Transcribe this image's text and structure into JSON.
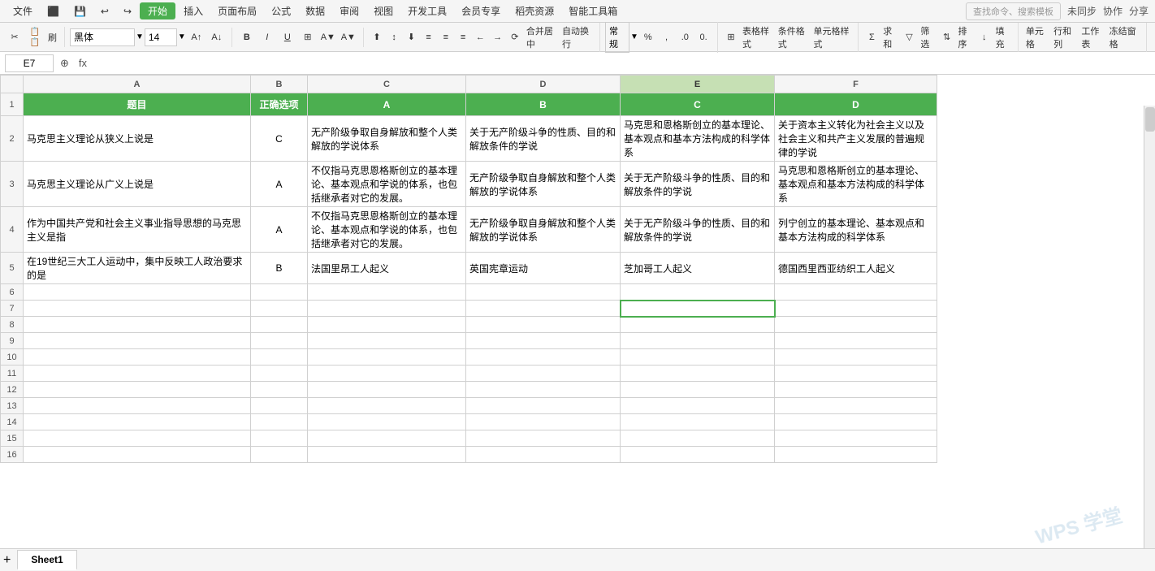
{
  "menubar": {
    "items": [
      "文件",
      "插入",
      "页面布局",
      "公式",
      "数据",
      "审阅",
      "视图",
      "开发工具",
      "会员专享",
      "稻壳资源",
      "智能工具箱"
    ],
    "start_label": "开始",
    "search_placeholder": "查找命令、搜索模板",
    "right_items": [
      "未同步",
      "协作",
      "分享"
    ]
  },
  "toolbar": {
    "font_name": "黑体",
    "font_size": "14",
    "bold": "B",
    "italic": "I",
    "underline": "U",
    "align_left": "≡",
    "align_center": "≡",
    "align_right": "≡",
    "merge": "合并居中",
    "wrap": "自动换行",
    "format": "常规",
    "table_style": "表格样式",
    "cond_format": "条件格式",
    "cell_style": "单元格样式",
    "sum": "求和",
    "filter": "筛选",
    "sort": "排序",
    "fill": "填充",
    "single_cell": "单元格",
    "row_col": "行和列",
    "work_area": "工作表",
    "freeze": "冻结窗格"
  },
  "formula_bar": {
    "cell_ref": "E7",
    "fx_label": "fx",
    "formula_value": ""
  },
  "columns": {
    "row_num_width": 28,
    "headers": [
      "A",
      "B",
      "C",
      "D",
      "E",
      "F"
    ],
    "col_labels": [
      "题目",
      "正确选项",
      "A",
      "B",
      "C",
      "D"
    ]
  },
  "rows": [
    {
      "row": 1,
      "cells": [
        "题目",
        "正确选项",
        "A",
        "B",
        "C",
        "D"
      ],
      "is_header": true
    },
    {
      "row": 2,
      "cells": [
        "马克思主义理论从狭义上说是",
        "C",
        "无产阶级争取自身解放和整个人类解放的学说体系",
        "关于无产阶级斗争的性质、目的和解放条件的学说",
        "马克思和恩格斯创立的基本理论、基本观点和基本方法构成的科学体系",
        "关于资本主义转化为社会主义以及社会主义和共产主义发展的普遍规律的学说"
      ]
    },
    {
      "row": 3,
      "cells": [
        "马克思主义理论从广义上说是",
        "A",
        "不仅指马克思恩格斯创立的基本理论、基本观点和学说的体系，也包括继承者对它的发展。",
        "无产阶级争取自身解放和整个人类解放的学说体系",
        "关于无产阶级斗争的性质、目的和解放条件的学说",
        "马克思和恩格斯创立的基本理论、基本观点和基本方法构成的科学体系"
      ]
    },
    {
      "row": 4,
      "cells": [
        "作为中国共产党和社会主义事业指导思想的马克思主义是指",
        "A",
        "不仅指马克思恩格斯创立的基本理论、基本观点和学说的体系，也包括继承者对它的发展。",
        "无产阶级争取自身解放和整个人类解放的学说体系",
        "关于无产阶级斗争的性质、目的和解放条件的学说",
        "列宁创立的基本理论、基本观点和基本方法构成的科学体系"
      ]
    },
    {
      "row": 5,
      "cells": [
        "在19世纪三大工人运动中，集中反映工人政治要求的是",
        "B",
        "法国里昂工人起义",
        "英国宪章运动",
        "芝加哥工人起义",
        "德国西里西亚纺织工人起义"
      ]
    },
    {
      "row": 6,
      "cells": [
        "",
        "",
        "",
        "",
        "",
        ""
      ]
    },
    {
      "row": 7,
      "cells": [
        "",
        "",
        "",
        "",
        "",
        ""
      ],
      "selected_col": 4
    },
    {
      "row": 8,
      "cells": [
        "",
        "",
        "",
        "",
        "",
        ""
      ]
    },
    {
      "row": 9,
      "cells": [
        "",
        "",
        "",
        "",
        "",
        ""
      ]
    },
    {
      "row": 10,
      "cells": [
        "",
        "",
        "",
        "",
        "",
        ""
      ]
    },
    {
      "row": 11,
      "cells": [
        "",
        "",
        "",
        "",
        "",
        ""
      ]
    },
    {
      "row": 12,
      "cells": [
        "",
        "",
        "",
        "",
        "",
        ""
      ]
    },
    {
      "row": 13,
      "cells": [
        "",
        "",
        "",
        "",
        "",
        ""
      ]
    },
    {
      "row": 14,
      "cells": [
        "",
        "",
        "",
        "",
        "",
        ""
      ]
    },
    {
      "row": 15,
      "cells": [
        "",
        "",
        "",
        "",
        "",
        ""
      ]
    },
    {
      "row": 16,
      "cells": [
        "",
        "",
        "",
        "",
        "",
        ""
      ]
    }
  ],
  "sheet_tab": "Sheet1",
  "watermark": "WPS 学堂"
}
